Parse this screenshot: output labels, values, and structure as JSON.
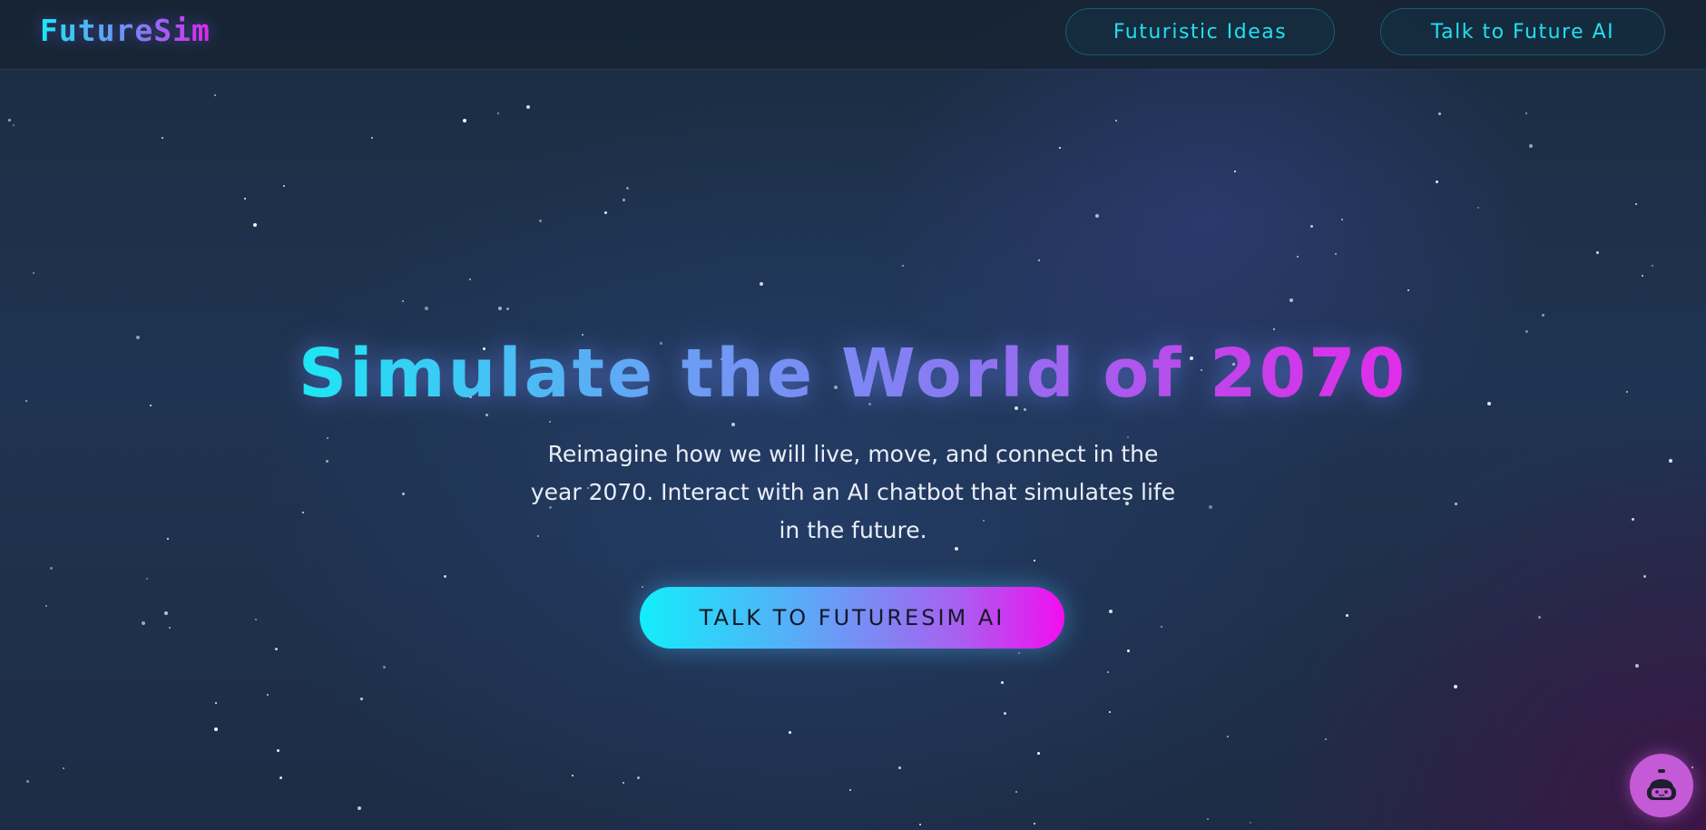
{
  "header": {
    "logo": "FutureSim",
    "nav": [
      {
        "label": "Futuristic Ideas"
      },
      {
        "label": "Talk to Future AI"
      }
    ]
  },
  "hero": {
    "title": "Simulate the World of 2070",
    "subtitle": "Reimagine how we will live, move, and connect in the year 2070. Interact with an AI chatbot that simulates life in the future.",
    "cta_label": "TALK TO FUTURESIM AI"
  },
  "chatbot": {
    "icon": "robot-icon"
  },
  "colors": {
    "accent_cyan": "#1ee6f4",
    "accent_magenta": "#e12cea",
    "background": "#1f3452",
    "bot_button": "#c45ad6"
  }
}
